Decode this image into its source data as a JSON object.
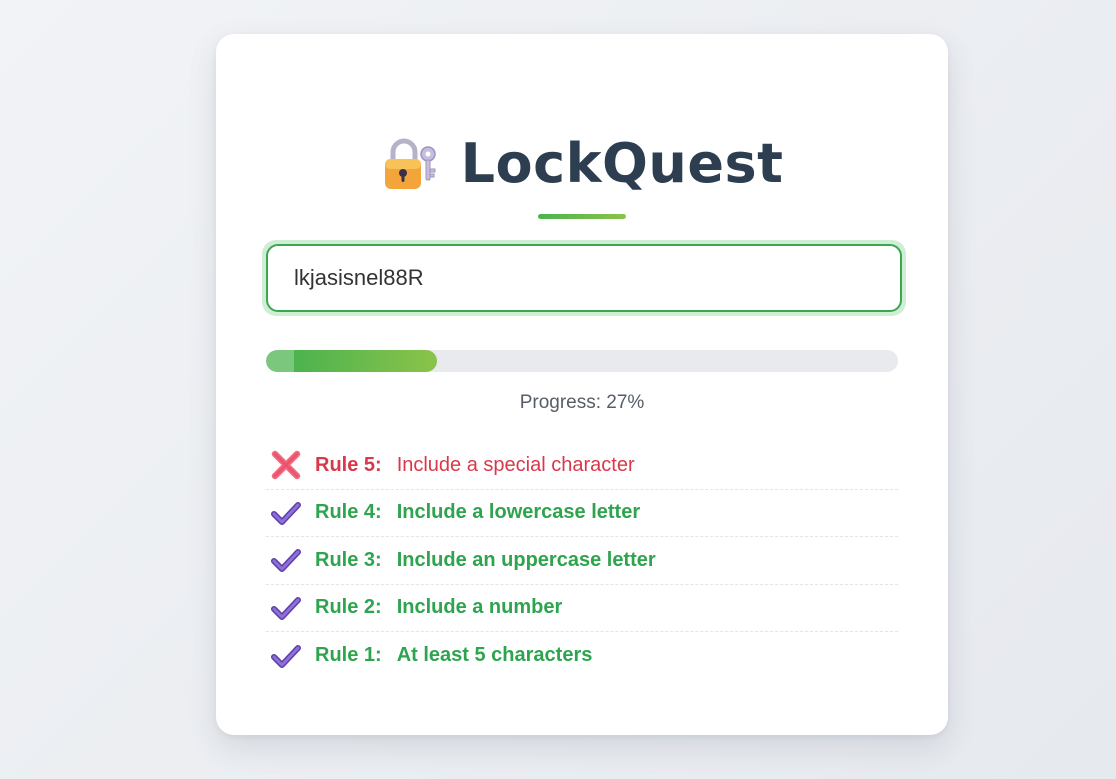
{
  "app": {
    "title": "LockQuest",
    "title_icon": "lock-with-key-icon"
  },
  "password": {
    "value": "lkjasisnel88R"
  },
  "progress": {
    "percent": 27,
    "label": "Progress: 27%"
  },
  "colors": {
    "accent": "#4cb34e",
    "fail": "#d9384a",
    "pass": "#2ea44f",
    "title": "#2d3e50"
  },
  "rules": [
    {
      "label": "Rule 5:",
      "text": "Include a special character",
      "status": "fail",
      "icon": "cross-mark-icon"
    },
    {
      "label": "Rule 4:",
      "text": "Include a lowercase letter",
      "status": "pass",
      "icon": "check-mark-icon"
    },
    {
      "label": "Rule 3:",
      "text": "Include an uppercase letter",
      "status": "pass",
      "icon": "check-mark-icon"
    },
    {
      "label": "Rule 2:",
      "text": "Include a number",
      "status": "pass",
      "icon": "check-mark-icon"
    },
    {
      "label": "Rule 1:",
      "text": "At least 5 characters",
      "status": "pass",
      "icon": "check-mark-icon"
    }
  ]
}
